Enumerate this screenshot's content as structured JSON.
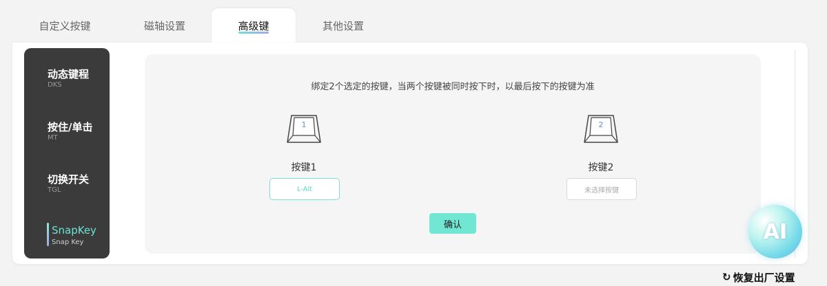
{
  "tabs": [
    {
      "label": "自定义按键"
    },
    {
      "label": "磁轴设置"
    },
    {
      "label": "高级键"
    },
    {
      "label": "其他设置"
    }
  ],
  "sidebar": {
    "items": [
      {
        "label": "动态键程",
        "sub": "DKS"
      },
      {
        "label": "按住/单击",
        "sub": "MT"
      },
      {
        "label": "切换开关",
        "sub": "TGL"
      },
      {
        "label": "SnapKey",
        "sub": "Snap Key"
      }
    ]
  },
  "content": {
    "description": "绑定2个选定的按键，当两个按键被同时按下时，以最后按下的按键为准",
    "key1": {
      "number": "1",
      "title": "按键1",
      "value": "L-Alt"
    },
    "key2": {
      "number": "2",
      "title": "按键2",
      "placeholder": "未选择按键"
    },
    "confirm_label": "确认"
  },
  "ai_badge": {
    "label": "AI"
  },
  "reset_label": "恢复出厂设置",
  "colors": {
    "accent": "#70e6d3",
    "sidebar_bg": "#3b3b3b"
  }
}
